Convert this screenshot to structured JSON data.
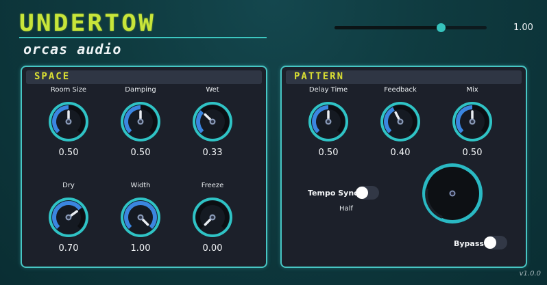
{
  "app": {
    "title": "UNDERTOW",
    "vendor": "orcas audio",
    "version": "v1.0.0"
  },
  "master": {
    "value": 1.0,
    "value_label": "1.00",
    "fraction": 0.7
  },
  "colors": {
    "accent": "#36c3bd",
    "title": "#c8e53a",
    "panel_title": "#d9de33",
    "knob_arc": "#3b86e0",
    "ring": "#2fc3c5"
  },
  "space": {
    "title": "SPACE",
    "knobs": [
      {
        "label": "Room Size",
        "value": 0.5,
        "value_label": "0.50"
      },
      {
        "label": "Damping",
        "value": 0.5,
        "value_label": "0.50"
      },
      {
        "label": "Wet",
        "value": 0.33,
        "value_label": "0.33"
      },
      {
        "label": "Dry",
        "value": 0.7,
        "value_label": "0.70"
      },
      {
        "label": "Width",
        "value": 1.0,
        "value_label": "1.00"
      },
      {
        "label": "Freeze",
        "value": 0.0,
        "value_label": "0.00"
      }
    ]
  },
  "pattern": {
    "title": "PATTERN",
    "knobs": [
      {
        "label": "Delay Time",
        "value": 0.5,
        "value_label": "0.50"
      },
      {
        "label": "Feedback",
        "value": 0.4,
        "value_label": "0.40"
      },
      {
        "label": "Mix",
        "value": 0.5,
        "value_label": "0.50"
      }
    ],
    "tempo_sync": {
      "label": "Tempo Sync",
      "on": false,
      "mode": "Half"
    },
    "bypass": {
      "label": "Bypass",
      "on": false
    }
  }
}
